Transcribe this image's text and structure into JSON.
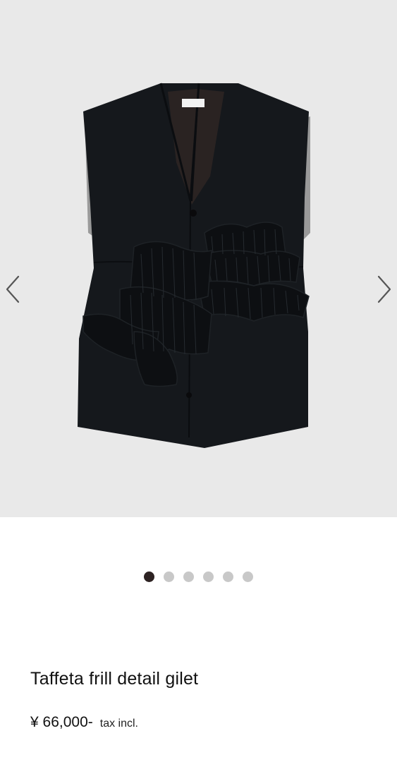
{
  "gallery": {
    "image_alt": "Taffeta frill detail gilet",
    "prev_icon": "chevron-left-icon",
    "next_icon": "chevron-right-icon",
    "slide_count": 6,
    "active_index": 0,
    "colors": {
      "background": "#e9e9e9",
      "garment": "#15181c",
      "dot_active": "#2d2222",
      "dot_inactive": "#c8c8c8"
    }
  },
  "product": {
    "title": "Taffeta frill detail gilet",
    "price": "¥ 66,000-",
    "tax_note": "tax incl."
  }
}
